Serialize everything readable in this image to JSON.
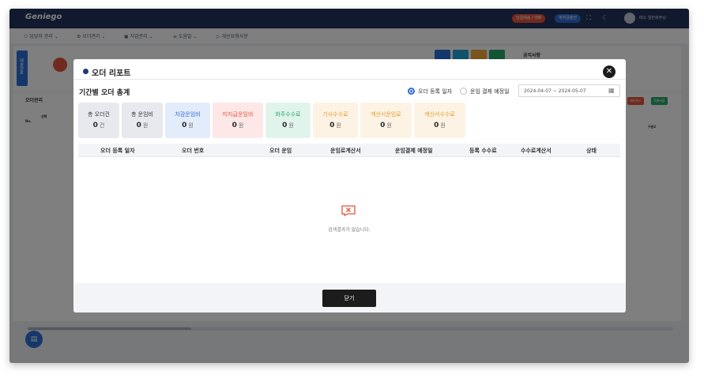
{
  "header": {
    "logo": "Geniego",
    "badges": [
      {
        "label": "당일배송 / 택배",
        "color": "#e2553b"
      },
      {
        "label": "계약금충전",
        "color": "#2d6fd6"
      }
    ],
    "user_label": "테오 일반화주님"
  },
  "nav": {
    "items": [
      "담당자 관리",
      "오더관리",
      "지감관리",
      "도움말",
      "개선요청사항"
    ]
  },
  "background": {
    "notice_title": "공지사항",
    "section_title": "오더관리",
    "side_tile_text": "배송현황",
    "col_select": "선택",
    "col_no": "No.",
    "col_right": "구분2",
    "mini_buttons": [
      {
        "label": "배차취소",
        "color": "#e2553b"
      },
      {
        "label": "엑셀저장",
        "color": "#27a86a"
      }
    ],
    "tile_colors": [
      "#2d6fd6",
      "#23a3d9",
      "#f2a93b",
      "#27a86a"
    ]
  },
  "modal": {
    "title": "오더 리포트",
    "section_title": "기간별 오더 총계",
    "radio_options": [
      {
        "label": "오더 등록 일자",
        "selected": true
      },
      {
        "label": "운임 결제 예정일",
        "selected": false
      }
    ],
    "date_range": "2024-04-07 ~ 2024-05-07",
    "summary_cards": [
      {
        "label": "총 오더건",
        "value": "0",
        "unit": "건",
        "bg": "#e8e9ee",
        "label_color": "#333333"
      },
      {
        "label": "총 운임비",
        "value": "0",
        "unit": "원",
        "bg": "#e8e9ee",
        "label_color": "#333333"
      },
      {
        "label": "차감운임비",
        "value": "0",
        "unit": "원",
        "bg": "#e3ecfb",
        "label_color": "#2d6fd6"
      },
      {
        "label": "미지급운임비",
        "value": "0",
        "unit": "원",
        "bg": "#fde7e7",
        "label_color": "#e2553b"
      },
      {
        "label": "화주수수료",
        "value": "0",
        "unit": "원",
        "bg": "#e0f4ec",
        "label_color": "#27a86a"
      },
      {
        "label": "기사수수료",
        "value": "0",
        "unit": "원",
        "bg": "#fdf3e4",
        "label_color": "#e69a2e"
      },
      {
        "label": "계산서운임료",
        "value": "0",
        "unit": "원",
        "bg": "#fdf3e4",
        "label_color": "#e69a2e"
      },
      {
        "label": "계산서수수료",
        "value": "0",
        "unit": "원",
        "bg": "#fdf3e4",
        "label_color": "#e69a2e"
      }
    ],
    "table_headers": [
      "오더 등록 일자",
      "오더 번호",
      "오더 운임",
      "운임료계산서",
      "운임결제 예정일",
      "등록 수수료",
      "수수료계산서",
      "상태"
    ],
    "empty_message": "검색결과가 없습니다.",
    "ok_label": "닫기"
  }
}
